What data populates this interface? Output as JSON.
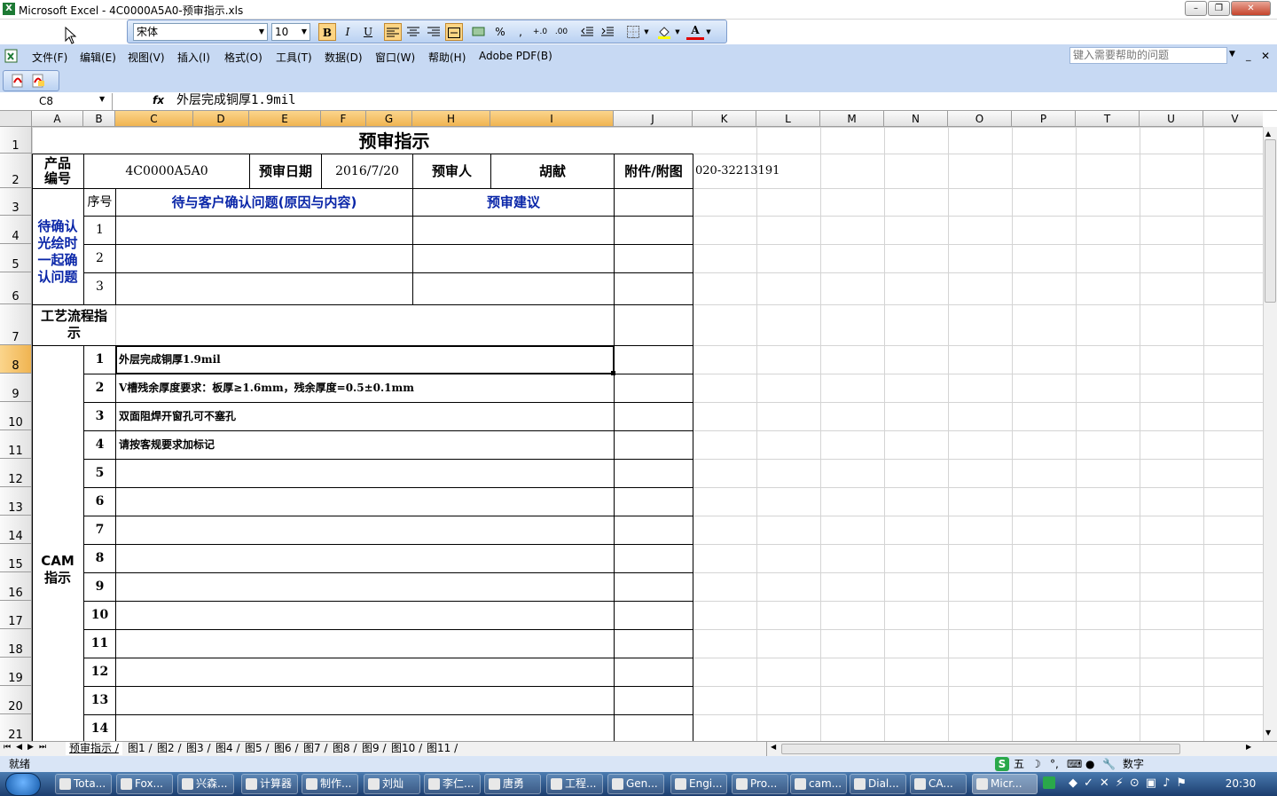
{
  "window": {
    "title": "Microsoft Excel - 4C0000A5A0-预审指示.xls",
    "minimize": "–",
    "restore": "❐",
    "close": "✕"
  },
  "format_toolbar": {
    "font": "宋体",
    "size": "10",
    "bold": "B",
    "italic": "I",
    "underline": "U",
    "percent": "%",
    "comma": ",",
    "inc_decimal": "+.0",
    "dec_decimal": ".00",
    "font_color_label": "A"
  },
  "menu": {
    "items": [
      "文件(F)",
      "编辑(E)",
      "视图(V)",
      "插入(I)",
      "格式(O)",
      "工具(T)",
      "数据(D)",
      "窗口(W)",
      "帮助(H)",
      "Adobe PDF(B)"
    ],
    "help_placeholder": "键入需要帮助的问题"
  },
  "formula_bar": {
    "name_box": "C8",
    "fx": "fx",
    "content": "外层完成铜厚1.9mil"
  },
  "columns": [
    "A",
    "B",
    "C",
    "D",
    "E",
    "F",
    "G",
    "H",
    "I",
    "J",
    "K",
    "L",
    "M",
    "N",
    "O",
    "P",
    "T",
    "U",
    "V"
  ],
  "rows": [
    "1",
    "2",
    "3",
    "4",
    "5",
    "6",
    "7",
    "8",
    "9",
    "10",
    "11",
    "12",
    "13",
    "14",
    "15",
    "16",
    "17",
    "18",
    "19",
    "20",
    "21"
  ],
  "sheet": {
    "title": "预审指示",
    "product_label": "产品编号",
    "product_code": "4C0000A5A0",
    "review_date_label": "预审日期",
    "review_date": "2016/7/20",
    "reviewer_label": "预审人",
    "reviewer": "胡献",
    "attachment_label": "附件/附图",
    "phone": "020-32213191",
    "pending_label": "待确认光绘时一起确认问题",
    "seq_label": "序号",
    "question_header": "待与客户确认问题(原因与内容)",
    "suggest_header": "预审建议",
    "pending_rows": [
      "1",
      "2",
      "3"
    ],
    "process_label": "工艺流程指示",
    "cam_label": "CAM指示",
    "cam_numbers": [
      "1",
      "2",
      "3",
      "4",
      "5",
      "6",
      "7",
      "8",
      "9",
      "10",
      "11",
      "12",
      "13",
      "14"
    ],
    "cam_items": [
      "外层完成铜厚1.9mil",
      "V槽残余厚度要求：板厚≥1.6mm，残余厚度=0.5±0.1mm",
      "双面阻焊开窗孔可不塞孔",
      "请按客规要求加标记"
    ]
  },
  "sheet_tabs": [
    "预审指示",
    "图1",
    "图2",
    "图3",
    "图4",
    "图5",
    "图6",
    "图7",
    "图8",
    "图9",
    "图10",
    "图11"
  ],
  "status": {
    "ready": "就绪",
    "numlock": "数字",
    "ime": "五"
  },
  "taskbar": {
    "items": [
      "Tota...",
      "Fox...",
      "兴森...",
      "计算器",
      "制作...",
      "刘灿",
      "李仁...",
      "唐勇",
      "工程...",
      "Gen...",
      "Engi...",
      "Pro...",
      "cam...",
      "Dial...",
      "CA...",
      "Micr..."
    ],
    "clock": "20:30"
  }
}
